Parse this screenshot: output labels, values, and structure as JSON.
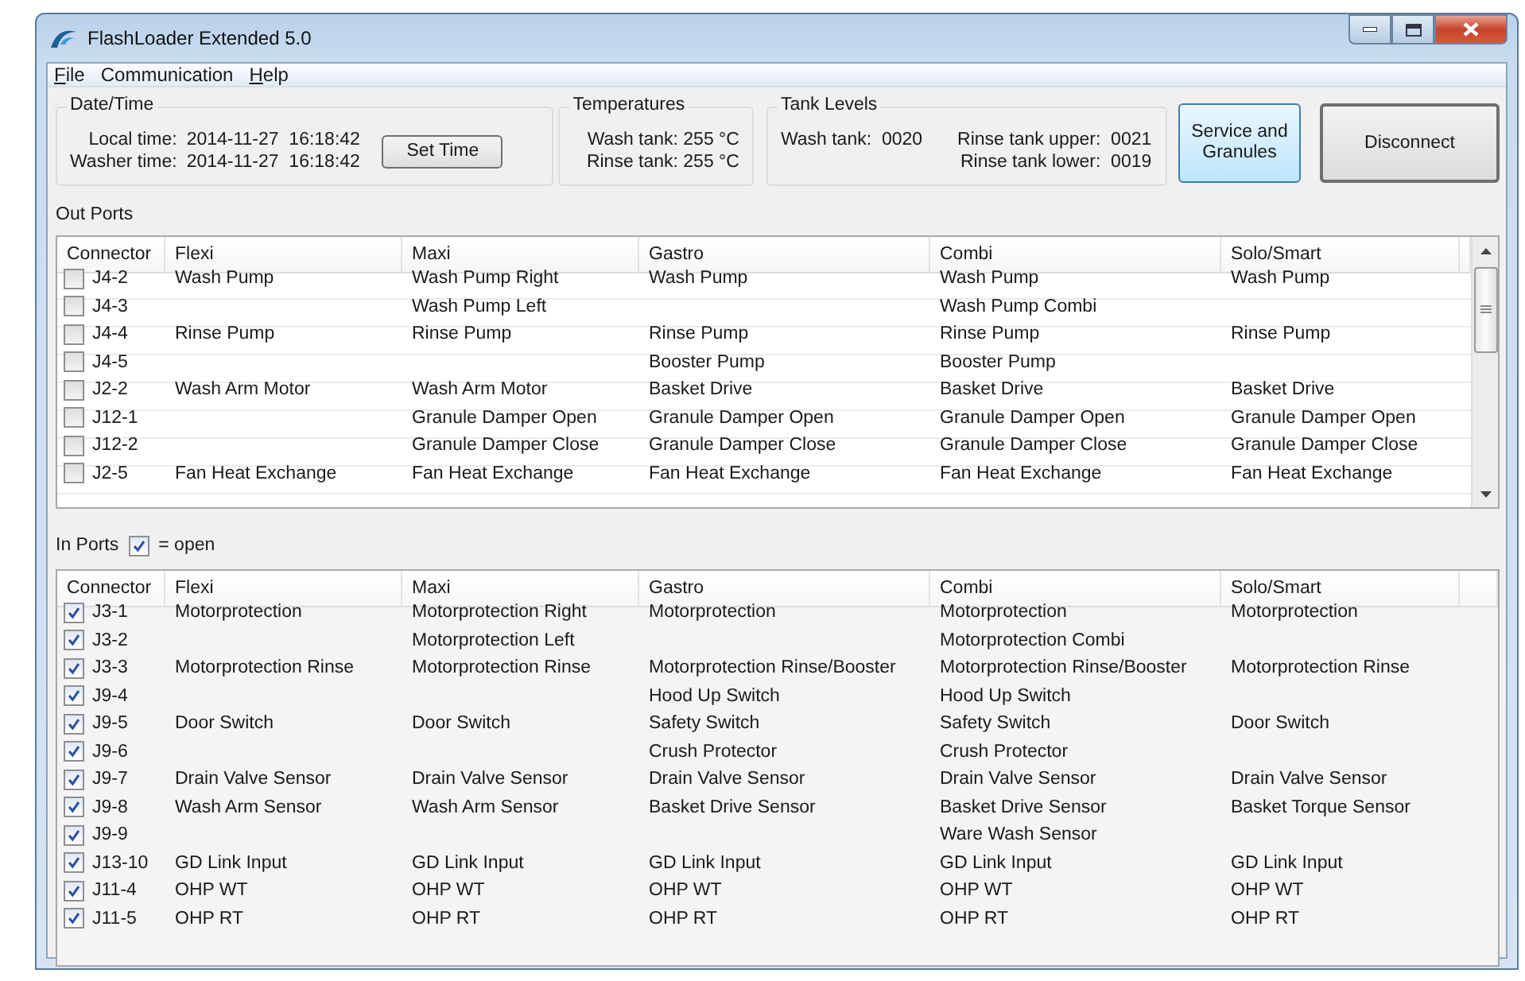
{
  "window": {
    "title": "FlashLoader Extended 5.0"
  },
  "menu": [
    {
      "label": "File",
      "mnemonic": true
    },
    {
      "label": "Communication",
      "mnemonic": false
    },
    {
      "label": "Help",
      "mnemonic": true
    }
  ],
  "date_time": {
    "title": "Date/Time",
    "local_label": "Local time:",
    "local_value": "2014-11-27  16:18:42",
    "washer_label": "Washer time:",
    "washer_value": "2014-11-27  16:18:42",
    "button": "Set Time"
  },
  "temperatures": {
    "title": "Temperatures",
    "wash": "Wash tank: 255 °C",
    "rinse": "Rinse tank: 255 °C"
  },
  "tank_levels": {
    "title": "Tank Levels",
    "wash": "Wash tank:  0020",
    "rinse_upper": "Rinse tank upper:  0021",
    "rinse_lower": "Rinse tank lower:  0019"
  },
  "buttons": [
    {
      "label": "Service and Granules",
      "kind": "highlighted"
    },
    {
      "label": "Disconnect",
      "kind": "normal"
    }
  ],
  "out_ports": {
    "title": "Out Ports",
    "columns": [
      "Connector",
      "Flexi",
      "Maxi",
      "Gastro",
      "Combi",
      "Solo/Smart"
    ],
    "rows": [
      {
        "connector": "J4-2",
        "checked": false,
        "flexi": "Wash Pump",
        "maxi": "Wash Pump Right",
        "gastro": "Wash Pump",
        "combi": "Wash Pump",
        "solo_smart": "Wash Pump"
      },
      {
        "connector": "J4-3",
        "checked": false,
        "maxi": "Wash Pump Left",
        "combi": "Wash Pump Combi"
      },
      {
        "connector": "J4-4",
        "checked": false,
        "flexi": "Rinse Pump",
        "maxi": "Rinse Pump",
        "gastro": "Rinse Pump",
        "combi": "Rinse Pump",
        "solo_smart": "Rinse Pump"
      },
      {
        "connector": "J4-5",
        "checked": false,
        "gastro": "Booster Pump",
        "combi": "Booster Pump"
      },
      {
        "connector": "J2-2",
        "checked": false,
        "flexi": "Wash Arm Motor",
        "maxi": "Wash Arm Motor",
        "gastro": "Basket Drive",
        "combi": "Basket Drive",
        "solo_smart": "Basket Drive"
      },
      {
        "connector": "J12-1",
        "checked": false,
        "maxi": "Granule Damper Open",
        "gastro": "Granule Damper Open",
        "combi": "Granule Damper Open",
        "solo_smart": "Granule Damper Open"
      },
      {
        "connector": "J12-2",
        "checked": false,
        "maxi": "Granule Damper Close",
        "gastro": "Granule Damper Close",
        "combi": "Granule Damper Close",
        "solo_smart": "Granule Damper Close"
      },
      {
        "connector": "J2-5",
        "checked": false,
        "flexi": "Fan Heat Exchange",
        "maxi": "Fan Heat Exchange",
        "gastro": "Fan Heat Exchange",
        "combi": "Fan Heat Exchange",
        "solo_smart": "Fan Heat Exchange"
      }
    ]
  },
  "in_ports": {
    "title": "In Ports",
    "legend_checked": true,
    "legend": "= open",
    "columns": [
      "Connector",
      "Flexi",
      "Maxi",
      "Gastro",
      "Combi",
      "Solo/Smart"
    ],
    "rows": [
      {
        "connector": "J3-1",
        "checked": true,
        "flexi": "Motorprotection",
        "maxi": "Motorprotection Right",
        "gastro": "Motorprotection",
        "combi": "Motorprotection",
        "solo_smart": "Motorprotection"
      },
      {
        "connector": "J3-2",
        "checked": true,
        "maxi": "Motorprotection Left",
        "combi": "Motorprotection Combi"
      },
      {
        "connector": "J3-3",
        "checked": true,
        "flexi": "Motorprotection Rinse",
        "maxi": "Motorprotection Rinse",
        "gastro": "Motorprotection Rinse/Booster",
        "combi": "Motorprotection Rinse/Booster",
        "solo_smart": "Motorprotection Rinse"
      },
      {
        "connector": "J9-4",
        "checked": true,
        "gastro": "Hood Up Switch",
        "combi": "Hood Up Switch"
      },
      {
        "connector": "J9-5",
        "checked": true,
        "flexi": "Door Switch",
        "maxi": "Door Switch",
        "gastro": "Safety Switch",
        "combi": "Safety Switch",
        "solo_smart": "Door Switch"
      },
      {
        "connector": "J9-6",
        "checked": true,
        "gastro": "Crush Protector",
        "combi": "Crush Protector"
      },
      {
        "connector": "J9-7",
        "checked": true,
        "flexi": "Drain Valve Sensor",
        "maxi": "Drain Valve Sensor",
        "gastro": "Drain Valve Sensor",
        "combi": "Drain Valve Sensor",
        "solo_smart": "Drain Valve Sensor"
      },
      {
        "connector": "J9-8",
        "checked": true,
        "flexi": "Wash Arm Sensor",
        "maxi": "Wash Arm Sensor",
        "gastro": "Basket Drive Sensor",
        "combi": "Basket Drive Sensor",
        "solo_smart": "Basket Torque Sensor"
      },
      {
        "connector": "J9-9",
        "checked": true,
        "combi": "Ware Wash Sensor"
      },
      {
        "connector": "J13-10",
        "checked": true,
        "flexi": "GD Link Input",
        "maxi": "GD Link Input",
        "gastro": "GD Link Input",
        "combi": "GD Link Input",
        "solo_smart": "GD Link Input"
      },
      {
        "connector": "J11-4",
        "checked": true,
        "flexi": "OHP WT",
        "maxi": "OHP WT",
        "gastro": "OHP WT",
        "combi": "OHP WT",
        "solo_smart": "OHP WT"
      },
      {
        "connector": "J11-5",
        "checked": true,
        "flexi": "OHP RT",
        "maxi": "OHP RT",
        "gastro": "OHP RT",
        "combi": "OHP RT",
        "solo_smart": "OHP RT"
      }
    ]
  }
}
